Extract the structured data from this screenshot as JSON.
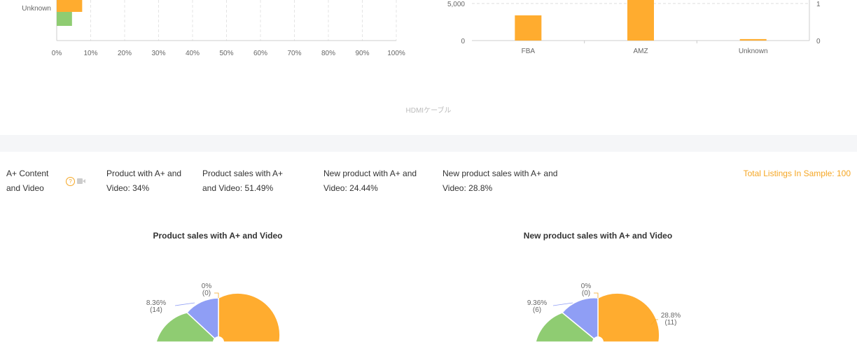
{
  "top_left_chart": {
    "category_label": "Unknown",
    "ticks": [
      "0%",
      "10%",
      "20%",
      "30%",
      "40%",
      "50%",
      "60%",
      "70%",
      "80%",
      "90%",
      "100%"
    ],
    "bars": [
      {
        "series": "orange",
        "value_pct": 7.5,
        "color": "#ffac2f"
      },
      {
        "series": "green",
        "value_pct": 4.5,
        "color": "#8fcc72"
      }
    ]
  },
  "top_right_chart": {
    "categories": [
      "FBA",
      "AMZ",
      "Unknown"
    ],
    "left_ticks": [
      "0",
      "5,000"
    ],
    "right_ticks": [
      "0",
      "1"
    ],
    "values": [
      3400,
      12000,
      200
    ],
    "ylim": [
      0,
      10000
    ],
    "color": "#ffac2f"
  },
  "keyword_label": "HDMIケーブル",
  "aplus": {
    "label": "A+ Content and Video",
    "stats": [
      "Product with A+ and Video: 34%",
      "Product sales with A+ and Video: 51.49%",
      "New product with A+ and Video: 24.44%",
      "New product sales with A+ and Video: 28.8%"
    ],
    "total": "Total Listings In Sample: 100"
  },
  "pies": [
    {
      "title": "Product sales with A+ and Video",
      "labels": [
        {
          "pct": "0%",
          "count": "(0)"
        },
        {
          "pct": "8.36%",
          "count": "(14)"
        }
      ]
    },
    {
      "title": "New product sales with A+ and Video",
      "labels": [
        {
          "pct": "0%",
          "count": "(0)"
        },
        {
          "pct": "9.36%",
          "count": "(6)"
        },
        {
          "pct": "28.8%",
          "count": "(11)"
        }
      ]
    }
  ],
  "colors": {
    "orange": "#ffac2f",
    "green": "#8fcc72",
    "blue": "#8f9ef5",
    "accent": "#f5a623"
  }
}
